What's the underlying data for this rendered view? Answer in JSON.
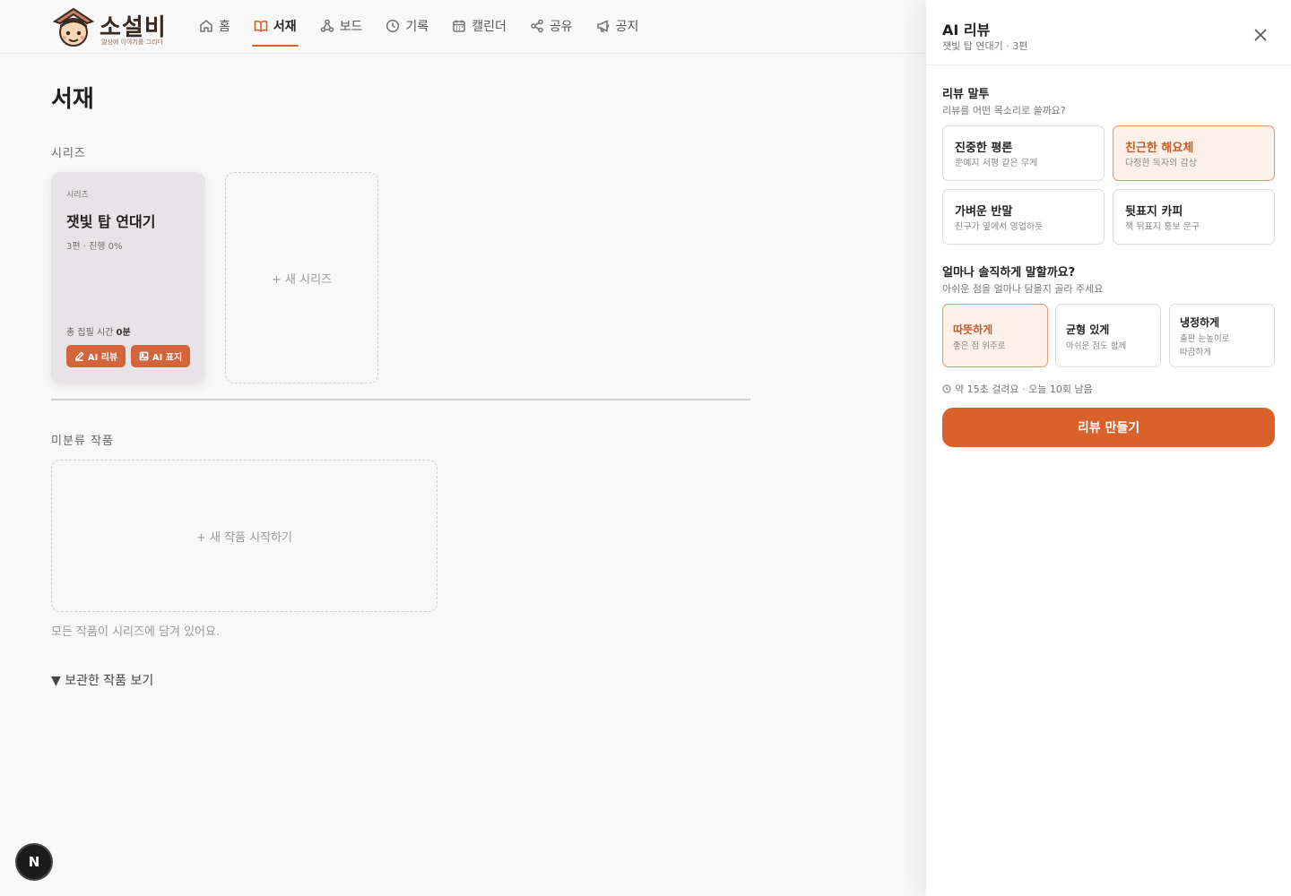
{
  "header": {
    "logo_text": "소설비",
    "logo_sub": "일상에 이야기를 그리다",
    "nav": [
      {
        "label": "홈",
        "icon": "home-icon"
      },
      {
        "label": "서재",
        "icon": "book-icon",
        "active": true
      },
      {
        "label": "보드",
        "icon": "board-icon"
      },
      {
        "label": "기록",
        "icon": "clock-icon"
      },
      {
        "label": "캘린더",
        "icon": "calendar-icon"
      },
      {
        "label": "공유",
        "icon": "share-icon"
      },
      {
        "label": "공지",
        "icon": "megaphone-icon"
      }
    ]
  },
  "main": {
    "title": "서재",
    "series_section_label": "시리즈",
    "series_card": {
      "kicker": "시리즈",
      "title": "잿빛 탑 연대기",
      "meta": "3편 · 진행 0%",
      "time_label": "총 집필 시간",
      "time_value": "0분",
      "review_btn": "AI 리뷰",
      "cover_btn": "AI 표지"
    },
    "new_series": "+ 새 시리즈",
    "unsorted_label": "미분류 작품",
    "new_work": "+ 새 작품 시작하기",
    "empty_note": "모든 작품이 시리즈에 담겨 있어요.",
    "archive_toggle": "▼ 보관한 작품 보기",
    "fab": "N"
  },
  "panel": {
    "title": "AI 리뷰",
    "subtitle": "잿빛 탑 연대기 · 3편",
    "tone_title": "리뷰 말투",
    "tone_sub": "리뷰를 어떤 목소리로 쓸까요?",
    "tones": [
      {
        "label": "진중한 평론",
        "desc": "문예지 서평 같은 무게",
        "selected": false
      },
      {
        "label": "친근한 해요체",
        "desc": "다정한 독자의 감상",
        "selected": true
      },
      {
        "label": "가벼운 반말",
        "desc": "친구가 옆에서 영업하듯",
        "selected": false
      },
      {
        "label": "뒷표지 카피",
        "desc": "책 뒤표지 홍보 문구",
        "selected": false
      }
    ],
    "honesty_title": "얼마나 솔직하게 말할까요?",
    "honesty_sub": "아쉬운 점을 얼마나 담을지 골라 주세요",
    "honesty": [
      {
        "label": "따뜻하게",
        "desc": "좋은 점 위주로",
        "selected": true
      },
      {
        "label": "균형 있게",
        "desc": "아쉬운 점도 함께",
        "selected": false
      },
      {
        "label": "냉정하게",
        "desc_1": "출판 눈높이로",
        "desc_2": "따끔하게",
        "selected": false
      }
    ],
    "time_note": "약 15초 걸려요 · 오늘 10회 남음",
    "make_button": "리뷰 만들기"
  },
  "colors": {
    "accent": "#d9622b",
    "accent_light": "#fdf0e8",
    "series_card_bg": "#e8e3e6"
  }
}
